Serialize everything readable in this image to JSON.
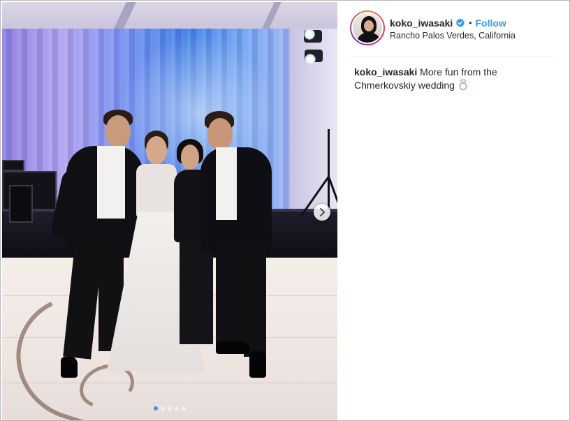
{
  "post": {
    "username": "koko_iwasaki",
    "verified": true,
    "separator": "•",
    "follow_label": "Follow",
    "location": "Rancho Palos Verdes, California",
    "caption": {
      "username": "koko_iwasaki",
      "text": "More fun from the Chmerkovskiy wedding"
    },
    "icons": {
      "verified": "verified-badge-icon",
      "next": "chevron-right-icon",
      "caption_emoji": "ring-icon"
    },
    "colors": {
      "link": "#3897f0",
      "text": "#262626"
    }
  },
  "carousel": {
    "slide_count": 5,
    "active_index": 0
  }
}
